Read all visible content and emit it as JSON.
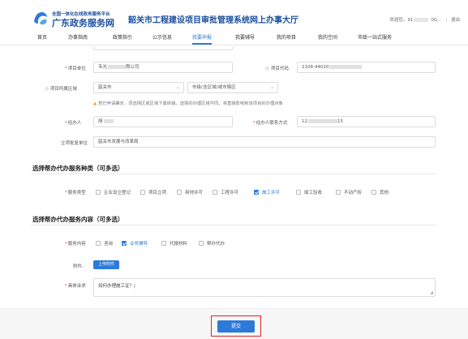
{
  "header": {
    "org_line1": "全国一体化在线政务服务平台",
    "org_line2": "广东政务服务网",
    "system_title": "韶关市工程建设项目审批管理系统网上办事大厅",
    "welcome": "欢迎您，91",
    "welcome_suffix": "0G…",
    "logout": "退出"
  },
  "nav": {
    "items": [
      "首页",
      "办事指南",
      "政策指引",
      "公示信息",
      "我要申报",
      "我要辅导",
      "我的项目",
      "我的空间",
      "市政一站式服务"
    ],
    "active_index": 4
  },
  "form": {
    "project_unit_label": "项目单位",
    "project_unit_value": "韦光",
    "project_unit_value_suffix": "限公司",
    "project_code_label": "项目代码",
    "project_code_value": "2108-44020",
    "project_code_value_suffix": "",
    "region_label": "项目所属区域",
    "region_city": "韶关市",
    "region_district_placeholder": "市级(含区域)或市辖区",
    "region_warning": "若已申请确定，须选择区或区域下属街镇，选择的办理区域不同，将直接影响到该项目的办理对象",
    "agent_label": "经办人",
    "agent_value": "胡",
    "agent_phone_label": "经办人联系方式",
    "agent_phone_value": "12",
    "agent_phone_suffix": "15",
    "approval_unit_label": "立项批复单位",
    "approval_unit_value": "韶关市发展与改革局"
  },
  "service_types": {
    "title": "选择帮办代办服务种类（可多选）",
    "label": "服务类型",
    "options": [
      {
        "label": "企业设立登记",
        "checked": false
      },
      {
        "label": "项目立项",
        "checked": false
      },
      {
        "label": "用地许可",
        "checked": false
      },
      {
        "label": "工程许可",
        "checked": false
      },
      {
        "label": "施工许可",
        "checked": true
      },
      {
        "label": "竣工验收",
        "checked": false
      },
      {
        "label": "不动产权",
        "checked": false
      },
      {
        "label": "其他",
        "checked": false
      }
    ]
  },
  "service_content": {
    "title": "选择帮办代办服务内容（可多选）",
    "label": "服务内容",
    "options": [
      {
        "label": "咨询",
        "checked": false
      },
      {
        "label": "业务辅导",
        "checked": true
      },
      {
        "label": "代报材料",
        "checked": false
      },
      {
        "label": "帮办代办",
        "checked": false
      }
    ],
    "attachment_label": "附件:",
    "upload_button": "上传附件",
    "request_label": "具体诉求",
    "request_value": "如何办理施工证？|"
  },
  "footer": {
    "submit_label": "提交"
  },
  "colors": {
    "accent": "#2d7bd8",
    "brand": "#1a4f9c",
    "required": "#e4393c",
    "highlight_frame": "#e02020"
  }
}
